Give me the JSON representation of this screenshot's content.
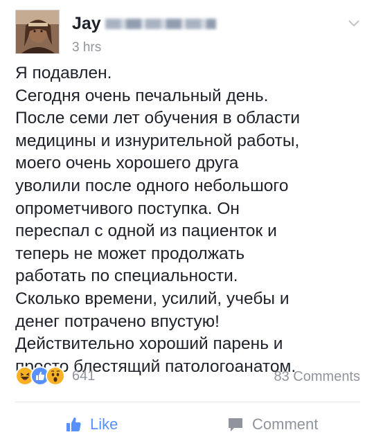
{
  "post": {
    "author_visible": "Jay",
    "timestamp": "3 hrs",
    "body_lines": [
      "Я подавлен.",
      "Сегодня очень печальный день.",
      "После семи лет обучения в области",
      "медицины и изнурительной работы,",
      "моего очень хорошего друга",
      "уволили после одного небольшого",
      "опрометчивого поступка. Он",
      "переспал с одной из пациенток и",
      "теперь не может продолжать",
      "работать по специальности.",
      "Сколько времени, усилий, учебы и",
      "денег потрачено впустую!",
      "Действительно хороший парень и",
      "просто блестящий патологоанатом."
    ]
  },
  "stats": {
    "reactions": [
      "haha-icon",
      "like-icon",
      "wow-icon"
    ],
    "reaction_count": "641",
    "comment_count": "83 Comments"
  },
  "actions": {
    "like_label": "Like",
    "comment_label": "Comment"
  },
  "colors": {
    "text": "#1d2129",
    "muted": "#90949c",
    "like_blue": "#5890ff",
    "haha_yellow": "#f7b125",
    "divider": "#e5e5e5"
  }
}
